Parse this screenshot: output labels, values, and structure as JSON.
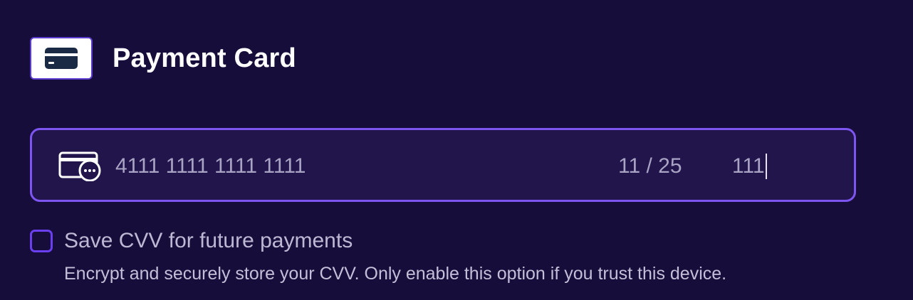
{
  "header": {
    "title": "Payment Card",
    "icon": "credit-card-icon"
  },
  "card_field": {
    "icon": "credit-card-chat-icon",
    "number": "4111 1111 1111 1111",
    "expiry": "11 / 25",
    "cvv": "111"
  },
  "save_cvv": {
    "checked": false,
    "label": "Save CVV for future payments",
    "helper": "Encrypt and securely store your CVV. Only enable this option if you trust this device."
  },
  "colors": {
    "background": "#170d3b",
    "field_background": "#21154c",
    "field_border": "#7d55f0",
    "checkbox_border": "#6a3ff0",
    "title_text": "#ffffff",
    "muted_text": "#a9a3c4"
  }
}
